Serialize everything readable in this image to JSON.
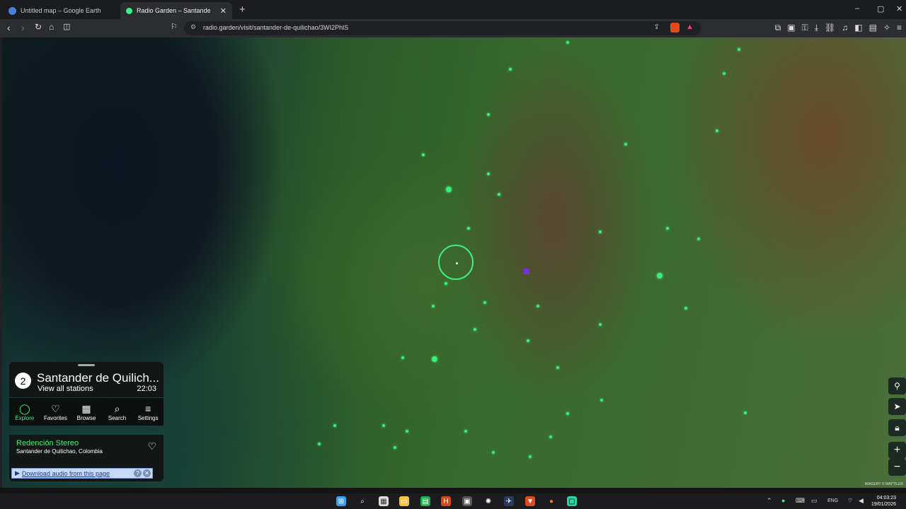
{
  "browser": {
    "tabs": [
      {
        "title": "Untitled map – Google Earth",
        "active": false
      },
      {
        "title": "Radio Garden – Santander de",
        "active": true
      }
    ],
    "new_tab": "+",
    "window_controls": {
      "minimize": "–",
      "maximize": "▢",
      "close": "✕"
    },
    "url": "radio.garden/visit/santander-de-quilichao/3WI2PhlS"
  },
  "map": {
    "attribution": "IMAGERY © MAPTILER",
    "controls": [
      "pin-icon",
      "locate-icon",
      "lock-icon",
      "zoom-in-icon",
      "zoom-out-icon"
    ]
  },
  "radio_panel": {
    "station_count": "2",
    "place_name": "Santander de Quilich...",
    "view_all": "View all stations",
    "local_time": "22:03"
  },
  "nav_tabs": [
    {
      "label": "Explore",
      "icon": "explore-icon",
      "active": true
    },
    {
      "label": "Favorites",
      "icon": "heart-icon",
      "active": false
    },
    {
      "label": "Browse",
      "icon": "map-icon",
      "active": false
    },
    {
      "label": "Search",
      "icon": "search-icon",
      "active": false
    },
    {
      "label": "Settings",
      "icon": "menu-icon",
      "active": false
    }
  ],
  "player": {
    "station_name": "Redención Stereo",
    "station_location": "Santander de Quilichao, Colombia"
  },
  "download_bar": {
    "label": "Download audio from this page"
  },
  "taskbar": {
    "language": "ENG",
    "time": "04:03:23",
    "date": "19/01/2026"
  },
  "colors": {
    "accent": "#3df27e",
    "panel": "#121716"
  }
}
